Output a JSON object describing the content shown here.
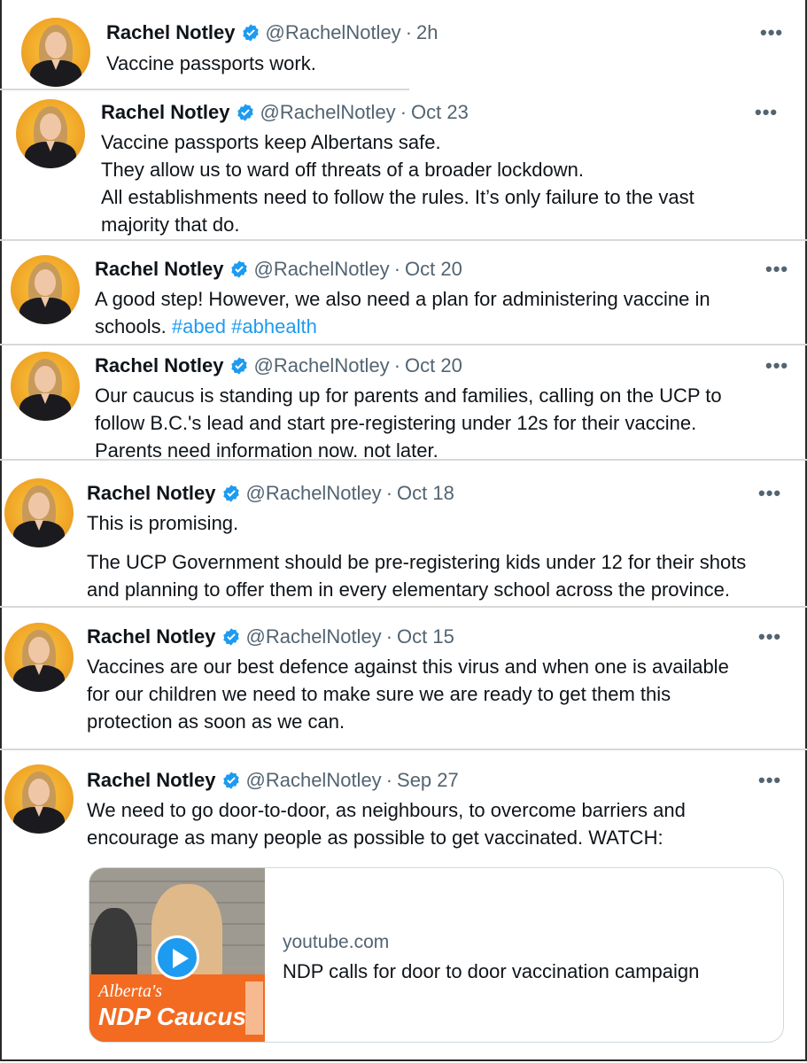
{
  "tweets": [
    {
      "name": "Rachel Notley",
      "handle": "@RachelNotley",
      "time": "2h",
      "lines": [
        "Vaccine passports work."
      ]
    },
    {
      "name": "Rachel Notley",
      "handle": "@RachelNotley",
      "time": "Oct 23",
      "lines": [
        "Vaccine passports keep Albertans safe.",
        "They allow us to ward off threats of a broader lockdown.",
        "All establishments need to follow the rules. It’s only failure to the vast",
        "majority that do."
      ]
    },
    {
      "name": "Rachel Notley",
      "handle": "@RachelNotley",
      "time": "Oct 20",
      "lines": [
        "A good step! However, we also need a plan for administering vaccine in",
        "schools."
      ],
      "hashtags": [
        "#abed",
        "#abhealth"
      ]
    },
    {
      "name": "Rachel Notley",
      "handle": "@RachelNotley",
      "time": "Oct 20",
      "lines": [
        "Our caucus is standing up for parents and families, calling on the UCP to",
        "follow B.C.'s lead and start pre-registering under 12s for their vaccine.",
        "Parents need information now. not later."
      ]
    },
    {
      "name": "Rachel Notley",
      "handle": "@RachelNotley",
      "time": "Oct 18",
      "lines": [
        "This is promising.",
        "The UCP Government should be pre-registering kids under 12 for their shots",
        "and planning to offer them in every elementary school across the province."
      ]
    },
    {
      "name": "Rachel Notley",
      "handle": "@RachelNotley",
      "time": "Oct 15",
      "lines": [
        "Vaccines are our best defence against this virus and when one is available",
        "for our children we need to make sure we are ready to get them this",
        "protection as soon as we can."
      ]
    },
    {
      "name": "Rachel Notley",
      "handle": "@RachelNotley",
      "time": "Sep 27",
      "lines": [
        "We need to go door-to-door, as neighbours, to overcome barriers and",
        "encourage as many people as possible to get vaccinated. WATCH:"
      ],
      "card": {
        "domain": "youtube.com",
        "title": "NDP calls for door to door vaccination campaign",
        "thumb_line1": "Alberta's",
        "thumb_line2": "NDP Caucus"
      }
    }
  ],
  "separator": "·",
  "more_glyph": "•••",
  "colors": {
    "verified": "#1d9bf0",
    "hashtag": "#1d9bf0",
    "muted": "#536471",
    "brand_orange": "#f26b21"
  }
}
